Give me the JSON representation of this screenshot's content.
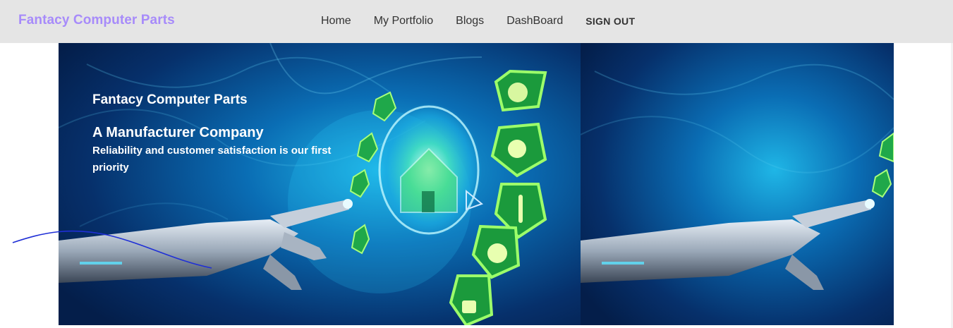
{
  "brand": {
    "name": "Fantacy Computer Parts",
    "color": "#a78bfa"
  },
  "nav": {
    "links": [
      "Home",
      "My Portfolio",
      "Blogs",
      "DashBoard"
    ],
    "signout": "SIGN OUT"
  },
  "hero": {
    "title": "Fantacy Computer Parts",
    "subtitle": "A Manufacturer Company",
    "tagline": "Reliability and customer satisfaction is our first priority",
    "accent_colors": {
      "glow_green": "#7CFC4F",
      "glow_cyan": "#2fd3ff",
      "background": "#06306b"
    },
    "icons": [
      "wifi-icon",
      "fan-icon",
      "lightbulb-icon",
      "thermometer-icon",
      "webcam-icon",
      "padlock-icon",
      "house-icon",
      "robot-hand-icon"
    ]
  }
}
